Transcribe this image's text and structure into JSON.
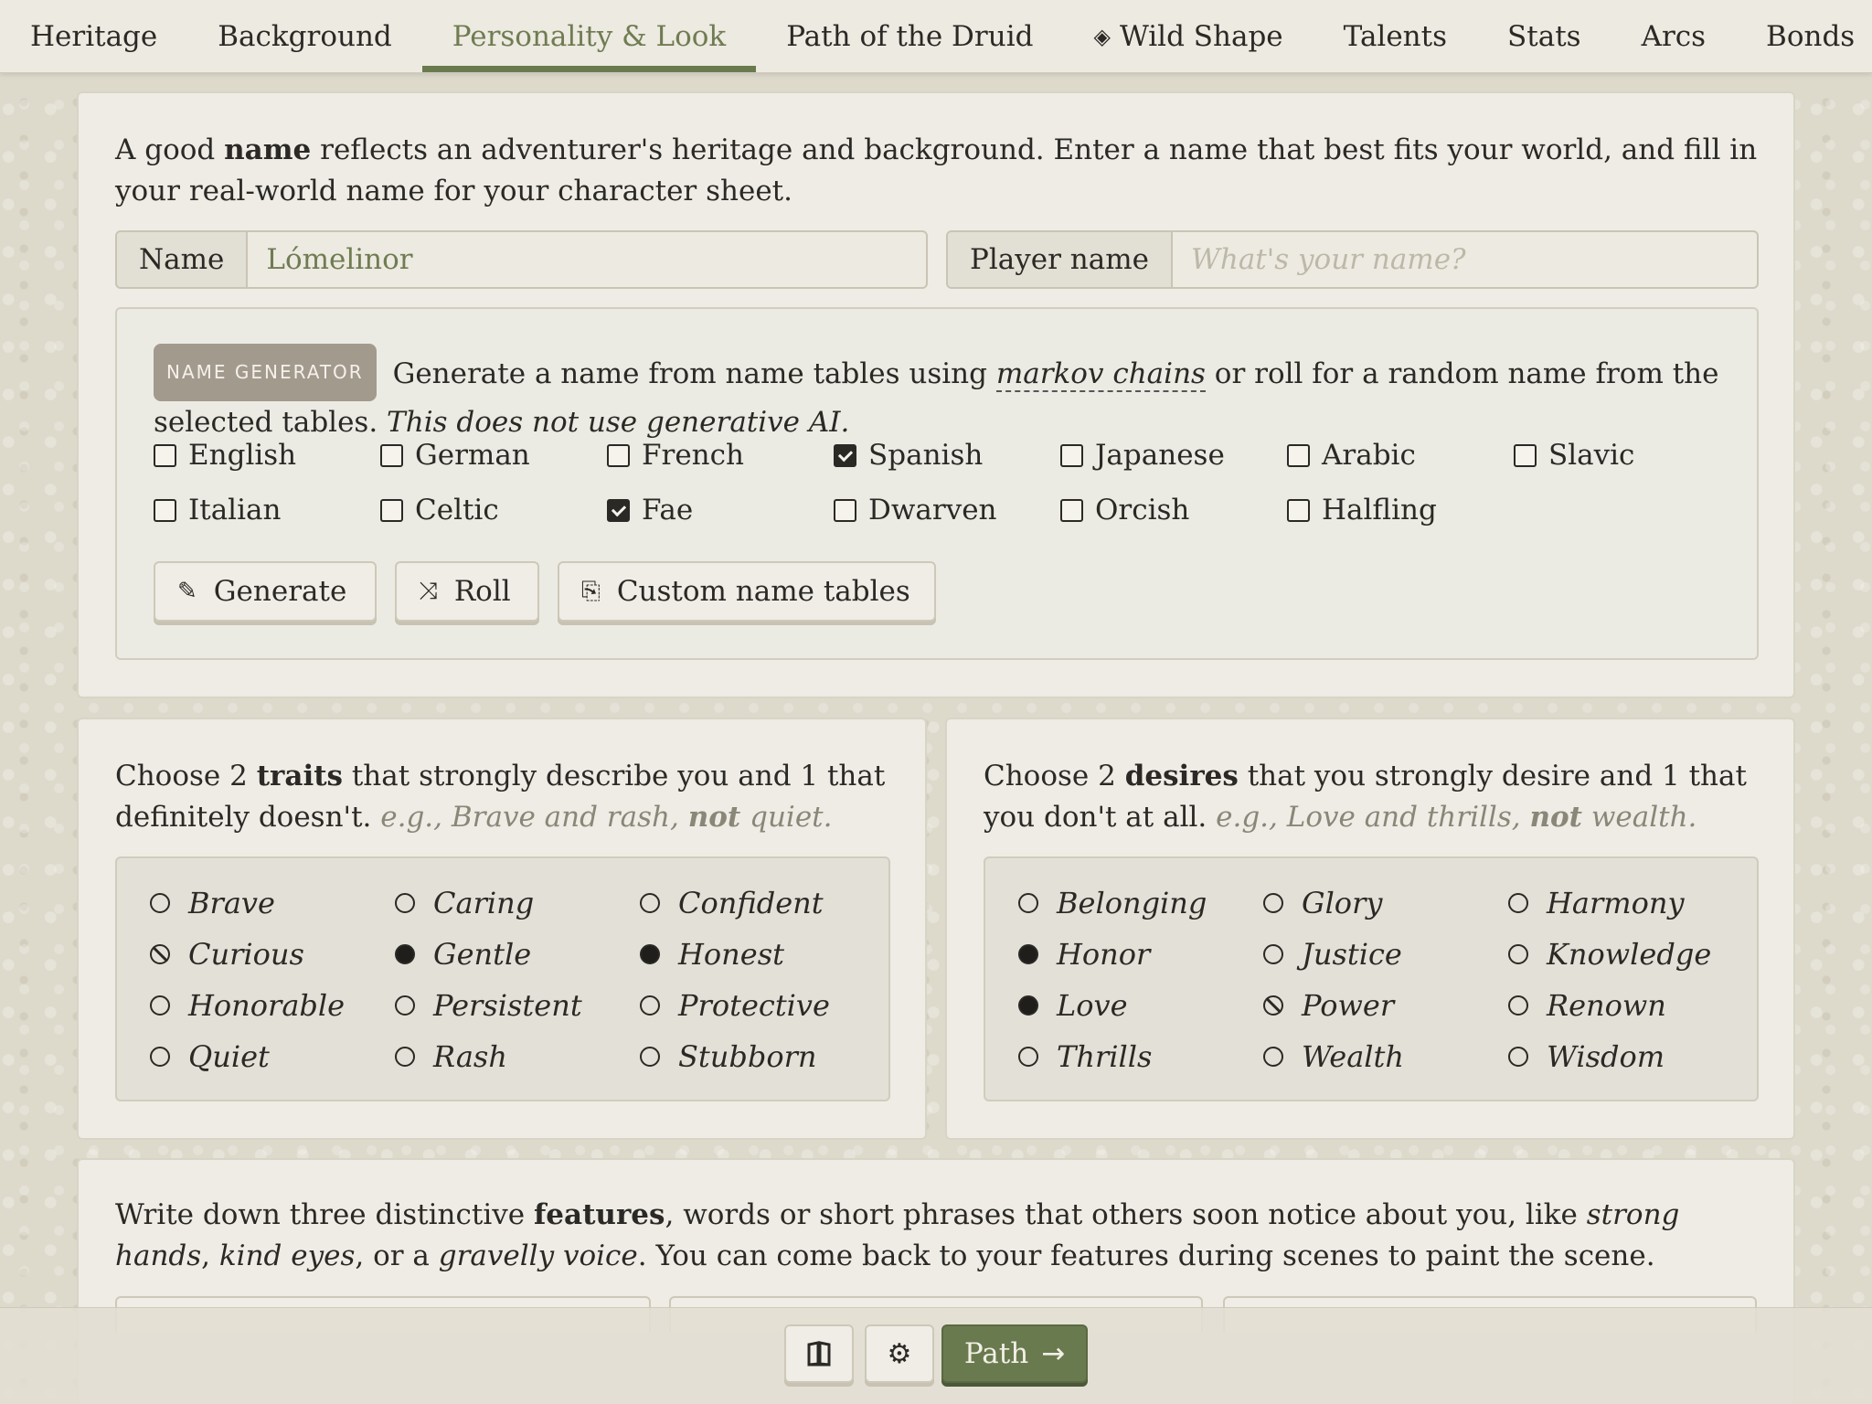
{
  "tabs": [
    {
      "label": "Heritage"
    },
    {
      "label": "Background"
    },
    {
      "label": "Personality & Look",
      "active": true
    },
    {
      "label": "Path of the Druid"
    },
    {
      "label": "Wild Shape",
      "icon": "diamond-icon"
    },
    {
      "label": "Talents"
    },
    {
      "label": "Stats"
    },
    {
      "label": "Arcs"
    },
    {
      "label": "Bonds"
    }
  ],
  "name_section": {
    "intro_pre": "A good ",
    "intro_bold": "name",
    "intro_post": " reflects an adventurer's heritage and background. Enter a name that best fits your world, and fill in your real-world name for your character sheet.",
    "name_label": "Name",
    "name_value": "Lómelinor",
    "player_label": "Player name",
    "player_value": "",
    "player_placeholder": "What's your name?"
  },
  "name_generator": {
    "badge": "NAME GENERATOR",
    "desc_pre": "Generate a name from name tables using ",
    "desc_link": "markov chains",
    "desc_post": " or roll for a random name from the selected tables. ",
    "desc_note": "This does not use generative AI.",
    "tables": [
      {
        "label": "English",
        "checked": false
      },
      {
        "label": "German",
        "checked": false
      },
      {
        "label": "French",
        "checked": false
      },
      {
        "label": "Spanish",
        "checked": true
      },
      {
        "label": "Japanese",
        "checked": false
      },
      {
        "label": "Arabic",
        "checked": false
      },
      {
        "label": "Slavic",
        "checked": false
      },
      {
        "label": "Italian",
        "checked": false
      },
      {
        "label": "Celtic",
        "checked": false
      },
      {
        "label": "Fae",
        "checked": true
      },
      {
        "label": "Dwarven",
        "checked": false
      },
      {
        "label": "Orcish",
        "checked": false
      },
      {
        "label": "Halfling",
        "checked": false
      }
    ],
    "generate_label": "Generate",
    "roll_label": "Roll",
    "custom_label": "Custom name tables"
  },
  "traits": {
    "prompt_pre": "Choose 2 ",
    "prompt_bold": "traits",
    "prompt_post": " that strongly describe you and 1 that definitely doesn't.",
    "example_pre": "e.g., Brave and rash, ",
    "example_bold": "not",
    "example_post": " quiet.",
    "options": [
      {
        "label": "Brave",
        "state": "empty"
      },
      {
        "label": "Caring",
        "state": "empty"
      },
      {
        "label": "Confident",
        "state": "empty"
      },
      {
        "label": "Curious",
        "state": "excluded"
      },
      {
        "label": "Gentle",
        "state": "selected"
      },
      {
        "label": "Honest",
        "state": "selected"
      },
      {
        "label": "Honorable",
        "state": "empty"
      },
      {
        "label": "Persistent",
        "state": "empty"
      },
      {
        "label": "Protective",
        "state": "empty"
      },
      {
        "label": "Quiet",
        "state": "empty"
      },
      {
        "label": "Rash",
        "state": "empty"
      },
      {
        "label": "Stubborn",
        "state": "empty"
      }
    ]
  },
  "desires": {
    "prompt_pre": "Choose 2 ",
    "prompt_bold": "desires",
    "prompt_post": " that you strongly desire and 1 that you don't at all.",
    "example_pre": "e.g., Love and thrills, ",
    "example_bold": "not",
    "example_post": " wealth.",
    "options": [
      {
        "label": "Belonging",
        "state": "empty"
      },
      {
        "label": "Glory",
        "state": "empty"
      },
      {
        "label": "Harmony",
        "state": "empty"
      },
      {
        "label": "Honor",
        "state": "selected"
      },
      {
        "label": "Justice",
        "state": "empty"
      },
      {
        "label": "Knowledge",
        "state": "empty"
      },
      {
        "label": "Love",
        "state": "selected"
      },
      {
        "label": "Power",
        "state": "excluded"
      },
      {
        "label": "Renown",
        "state": "empty"
      },
      {
        "label": "Thrills",
        "state": "empty"
      },
      {
        "label": "Wealth",
        "state": "empty"
      },
      {
        "label": "Wisdom",
        "state": "empty"
      }
    ]
  },
  "features": {
    "t1": "Write down three distinctive ",
    "b1": "features",
    "t2": ", words or short phrases that others soon notice about you, like ",
    "i1": "strong hands",
    "t3": ", ",
    "i2": "kind eyes",
    "t4": ", or a ",
    "i3": "gravelly voice",
    "t5": ". You can come back to your features during scenes to paint the scene."
  },
  "bottom_bar": {
    "book_icon": "book-icon",
    "settings_icon": "gear-icon",
    "next_label": "Path",
    "next_icon": "arrow-right-icon"
  },
  "colors": {
    "accent": "#6a7a4f",
    "page_bg": "#ddd9cb",
    "card_bg": "#eeece5"
  }
}
